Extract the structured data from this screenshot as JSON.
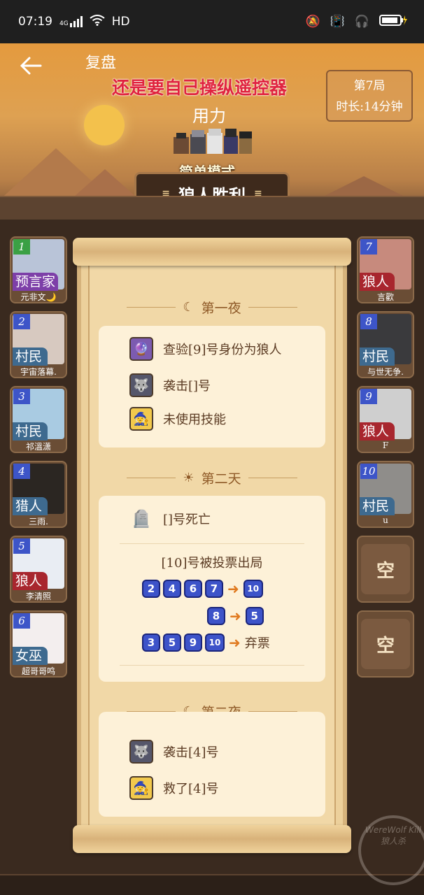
{
  "status_bar": {
    "time": "07:19",
    "network": "4G",
    "hd": "HD",
    "icons": [
      "signal-icon",
      "wifi-icon",
      "mute-icon",
      "vibrate-icon",
      "headphones-icon",
      "battery-charging-icon"
    ]
  },
  "header": {
    "back_icon": "arrow-left-icon",
    "title": "复盘",
    "overlay_red": "还是要自己操纵遥控器",
    "overlay_white": "用力",
    "round": "第7局",
    "duration": "时长:14分钟",
    "mode": "简单模式",
    "result": "狼人胜利"
  },
  "players_left": [
    {
      "num": "1",
      "role": "预言家",
      "name": "元非文🌙",
      "role_color": "#7d3fa8",
      "avatar_color": "#b9c4d8"
    },
    {
      "num": "2",
      "role": "村民",
      "name": "宇宙落幕.",
      "role_color": "#3e6a8f",
      "avatar_color": "#d7c9c0"
    },
    {
      "num": "3",
      "role": "村民",
      "name": "祁溫潇",
      "role_color": "#3e6a8f",
      "avatar_color": "#a9cbe2"
    },
    {
      "num": "4",
      "role": "猎人",
      "name": "三雨.",
      "role_color": "#3e6a8f",
      "avatar_color": "#2b2622"
    },
    {
      "num": "5",
      "role": "狼人",
      "name": "李清照",
      "role_color": "#a8262e",
      "avatar_color": "#e9edf3"
    },
    {
      "num": "6",
      "role": "女巫",
      "name": "超哥哥鸣",
      "role_color": "#3e6a8f",
      "avatar_color": "#f3eeee"
    }
  ],
  "players_right": [
    {
      "num": "7",
      "role": "狼人",
      "name": "言歡",
      "role_color": "#a8262e",
      "avatar_color": "#c78a7d"
    },
    {
      "num": "8",
      "role": "村民",
      "name": "与世无争.",
      "role_color": "#3e6a8f",
      "avatar_color": "#3a3a3d"
    },
    {
      "num": "9",
      "role": "狼人",
      "name": "F",
      "role_color": "#a8262e",
      "avatar_color": "#cfcfcf"
    },
    {
      "num": "10",
      "role": "村民",
      "name": "u",
      "role_color": "#3e6a8f",
      "avatar_color": "#8f8d8a"
    }
  ],
  "empty_seats": [
    "空",
    "空"
  ],
  "phases": {
    "night1": {
      "label": "第一夜",
      "icon": "moon-icon",
      "events": [
        {
          "icon": "seer-icon",
          "text": "查验[9]号身份为狼人"
        },
        {
          "icon": "werewolf-icon",
          "text": "袭击[]号"
        },
        {
          "icon": "witch-icon",
          "text": "未使用技能"
        }
      ]
    },
    "day2": {
      "label": "第二天",
      "icon": "sun-icon",
      "death": {
        "icon": "tombstone-icon",
        "text": "[]号死亡"
      },
      "vote_title": "[10]号被投票出局",
      "votes": [
        {
          "voters": [
            "2",
            "4",
            "6",
            "7"
          ],
          "target": "10"
        },
        {
          "voters": [
            "8"
          ],
          "target": "5"
        },
        {
          "voters": [
            "3",
            "5",
            "9",
            "10"
          ],
          "target_text": "弃票"
        }
      ]
    },
    "night2": {
      "label": "第二夜",
      "icon": "moon-icon",
      "events": [
        {
          "icon": "werewolf-icon",
          "text": "袭击[4]号"
        },
        {
          "icon": "witch-icon",
          "text": "救了[4]号"
        }
      ]
    }
  },
  "watermark": "WereWolf Kill 狼人杀"
}
